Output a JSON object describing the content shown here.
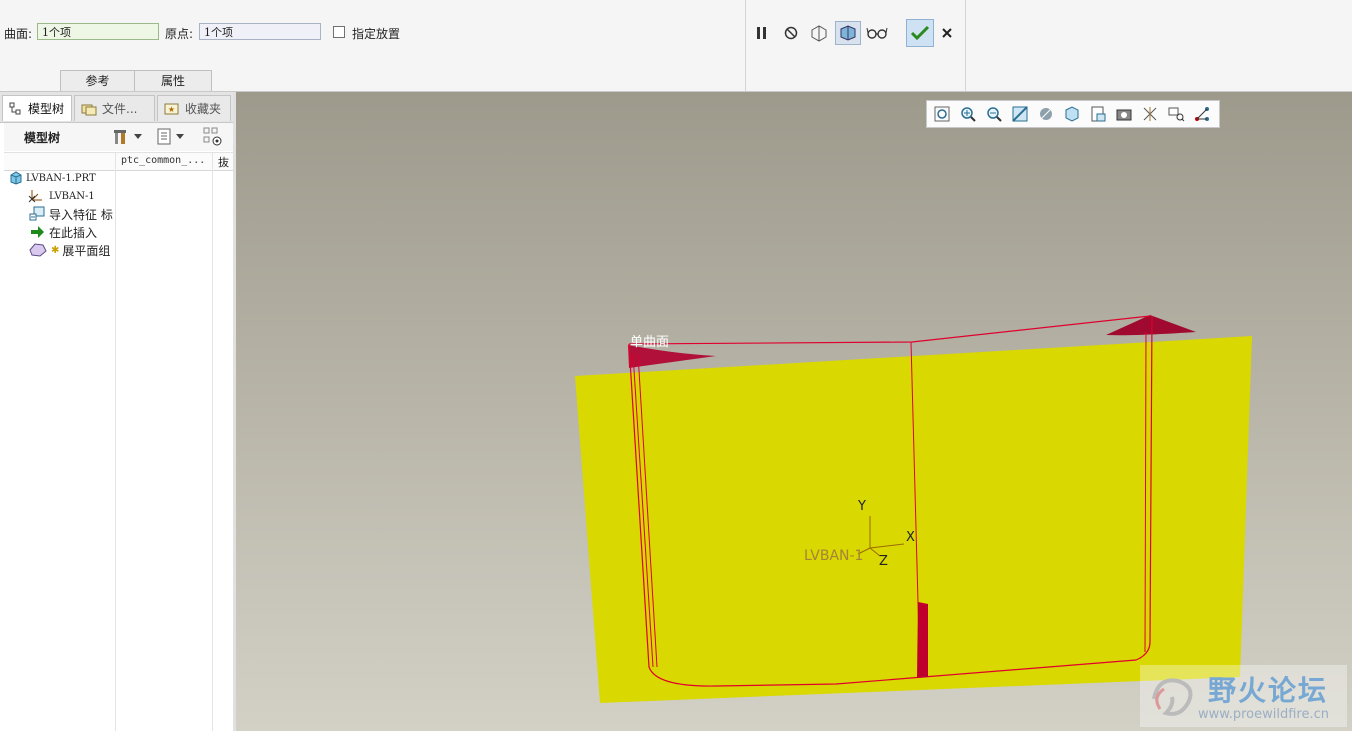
{
  "dashboard": {
    "surface_label": "曲面:",
    "surface_value": "1个项",
    "origin_label": "原点:",
    "origin_value": "1个项",
    "placement_label": "指定放置",
    "tabs": [
      "参考",
      "属性"
    ]
  },
  "navigator": {
    "tabs": [
      "模型树",
      "文件...",
      "收藏夹"
    ],
    "title": "模型树",
    "column_header": "ptc_common_...",
    "column_header2": "抜",
    "tree": [
      {
        "label": "LVBAN-1.PRT",
        "icon": "part-icon"
      },
      {
        "label": "LVBAN-1",
        "icon": "csys-icon"
      },
      {
        "label": "导入特征 标",
        "icon": "import-feature-icon"
      },
      {
        "label": "在此插入",
        "icon": "insert-here-arrow-icon"
      },
      {
        "label": "展平面组",
        "icon": "flatten-quilt-icon"
      }
    ]
  },
  "graphics": {
    "surface_label": "单曲面",
    "csys_name": "LVBAN-1",
    "axis_x": "X",
    "axis_y": "Y",
    "axis_z": "Z",
    "surface_color": "#d9d800",
    "edge_color": "#c8002c"
  },
  "watermark": {
    "title": "野火论坛",
    "url": "www.proewildfire.cn"
  }
}
